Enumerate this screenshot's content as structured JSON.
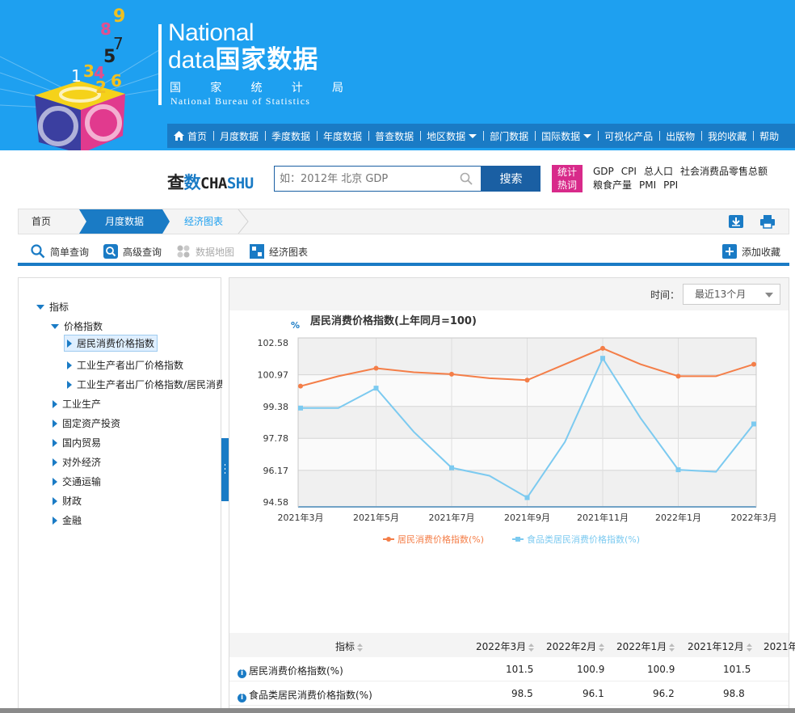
{
  "header": {
    "brand_line1": "National",
    "brand_line2_en": "data",
    "brand_line2_cn": "国家数据",
    "bureau_cn": [
      "国",
      "家",
      "统",
      "计",
      "局"
    ],
    "bureau_en": "National Bureau of Statistics",
    "logo_digits": [
      "1",
      "3",
      "4",
      "5",
      "6",
      "7",
      "8",
      "9",
      "2"
    ]
  },
  "main_nav": [
    {
      "label": "首页",
      "icon": "home-icon"
    },
    {
      "label": "月度数据"
    },
    {
      "label": "季度数据"
    },
    {
      "label": "年度数据"
    },
    {
      "label": "普查数据"
    },
    {
      "label": "地区数据",
      "dropdown": true
    },
    {
      "label": "部门数据"
    },
    {
      "label": "国际数据",
      "dropdown": true
    },
    {
      "label": "可视化产品"
    },
    {
      "label": "出版物"
    },
    {
      "label": "我的收藏"
    },
    {
      "label": "帮助"
    }
  ],
  "search": {
    "logo_cn1": "查",
    "logo_cn2": "数",
    "logo_en1": "CHA",
    "logo_en2": "SHU",
    "placeholder": "如：2012年 北京 GDP",
    "button": "搜索",
    "hot_badge_line1": "统计",
    "hot_badge_line2": "热词",
    "hot_words_row1": [
      "GDP",
      "CPI",
      "总人口",
      "社会消费品零售总额"
    ],
    "hot_words_row2": [
      "粮食产量",
      "PMI",
      "PPI"
    ]
  },
  "breadcrumb": {
    "home": "首页",
    "monthly": "月度数据",
    "current": "经济图表"
  },
  "toolbar": {
    "simple_query": "简单查询",
    "advanced_query": "高级查询",
    "data_map": "数据地图",
    "econ_chart": "经济图表",
    "add_favorite": "添加收藏"
  },
  "tree": {
    "root": "指标",
    "price_index": "价格指数",
    "cpi": "居民消费价格指数",
    "ppi": "工业生产者出厂价格指数",
    "ppi_cpi": "工业生产者出厂价格指数/居民消费价格指数",
    "items": [
      "工业生产",
      "固定资产投资",
      "国内贸易",
      "对外经济",
      "交通运输",
      "财政",
      "金融"
    ]
  },
  "chart_controls": {
    "time_label": "时间：",
    "time_value": "最近13个月"
  },
  "chart_data": {
    "type": "line",
    "title": "居民消费价格指数(上年同月=100)",
    "ylabel": "%",
    "x": [
      "2021年3月",
      "2021年4月",
      "2021年5月",
      "2021年6月",
      "2021年7月",
      "2021年8月",
      "2021年9月",
      "2021年10月",
      "2021年11月",
      "2021年12月",
      "2022年1月",
      "2022年2月",
      "2022年3月"
    ],
    "x_tick_labels": [
      "2021年3月",
      "2021年5月",
      "2021年7月",
      "2021年9月",
      "2021年11月",
      "2022年1月",
      "2022年3月"
    ],
    "y_ticks": [
      "102.58",
      "100.97",
      "99.38",
      "97.78",
      "96.17",
      "94.58"
    ],
    "ylim": [
      94.58,
      102.58
    ],
    "series": [
      {
        "name": "居民消费价格指数(%)",
        "color": "#f47e48",
        "marker": "circle",
        "values": [
          100.4,
          100.9,
          101.3,
          101.1,
          101.0,
          100.8,
          100.7,
          101.5,
          102.3,
          101.5,
          100.9,
          100.9,
          101.5
        ]
      },
      {
        "name": "食品类居民消费价格指数(%)",
        "color": "#7ccaf0",
        "marker": "square",
        "values": [
          99.3,
          99.3,
          100.3,
          98.1,
          96.3,
          95.9,
          94.8,
          97.6,
          101.8,
          98.8,
          96.2,
          96.1,
          98.5
        ]
      }
    ],
    "grid": true,
    "legend": "bottom-center"
  },
  "table": {
    "header": {
      "indicator": "指标",
      "cols": [
        "2022年3月",
        "2022年2月",
        "2022年1月",
        "2021年12月",
        "2021年11月"
      ]
    },
    "rows": [
      {
        "name": "居民消费价格指数(%)",
        "values": [
          "101.5",
          "100.9",
          "100.9",
          "101.5"
        ]
      },
      {
        "name": "食品类居民消费价格指数(%)",
        "values": [
          "98.5",
          "96.1",
          "96.2",
          "98.8"
        ]
      }
    ]
  }
}
